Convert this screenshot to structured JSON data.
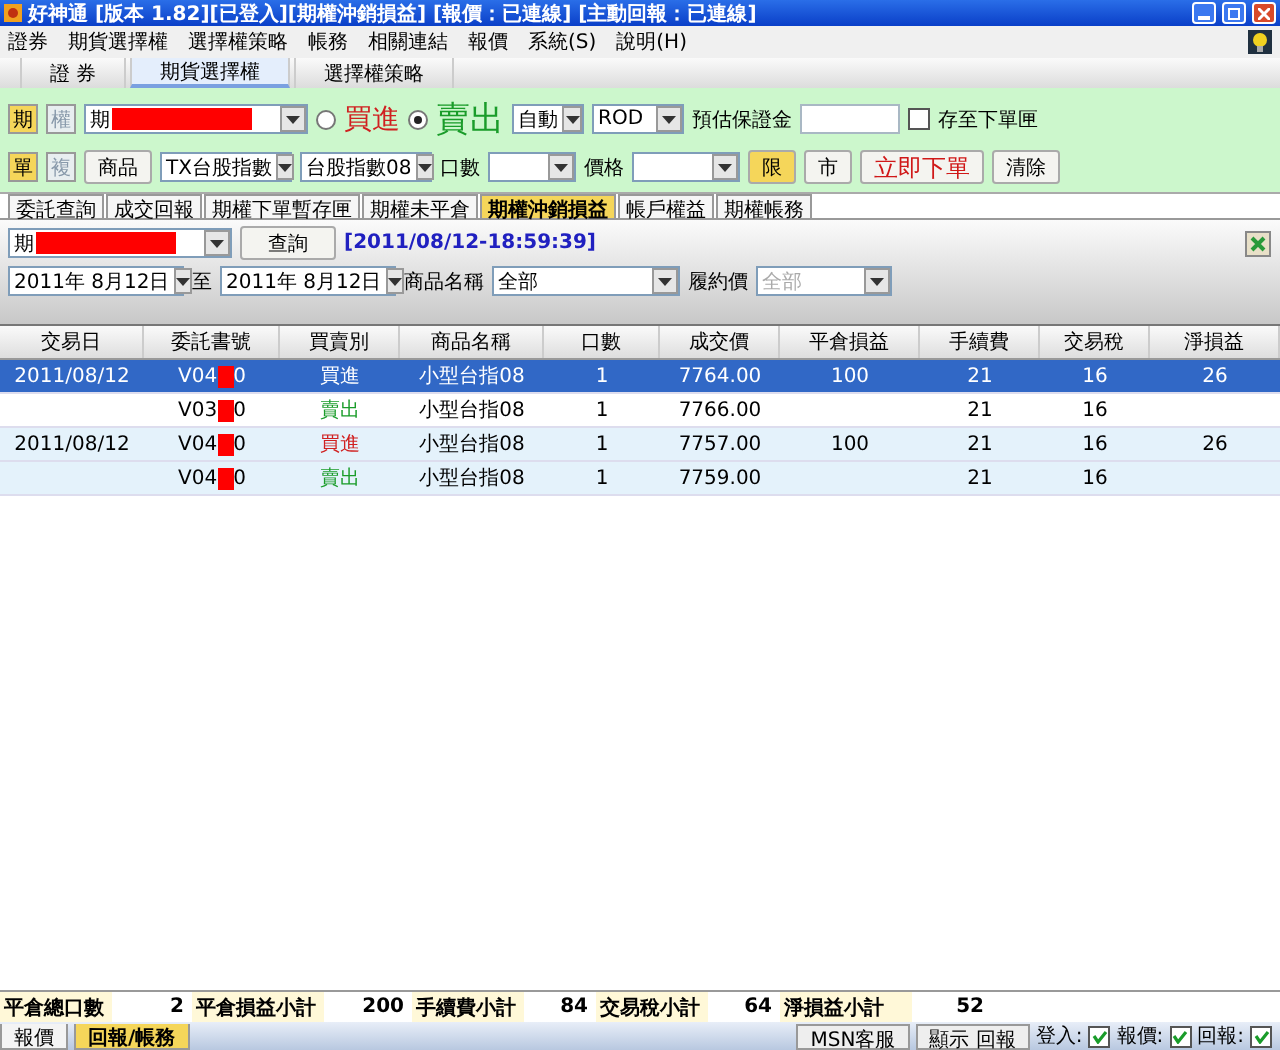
{
  "window": {
    "title": "好神通 [版本 1.82][已登入][期權沖銷損益] [報價：已連線] [主動回報：已連線]"
  },
  "menu": [
    "證券",
    "期貨選擇權",
    "選擇權策略",
    "帳務",
    "相關連結",
    "報價",
    "系統(S)",
    "說明(H)"
  ],
  "top_tabs": [
    {
      "label": "證 券",
      "selected": false
    },
    {
      "label": "期貨選擇權",
      "selected": true
    },
    {
      "label": "選擇權策略",
      "selected": false
    }
  ],
  "order": {
    "market_toggle": [
      {
        "label": "期",
        "selected": true
      },
      {
        "label": "權",
        "selected": false
      }
    ],
    "account": "期",
    "sides": [
      {
        "label": "買進",
        "selected": false
      },
      {
        "label": "賣出",
        "selected": true
      }
    ],
    "mode": "自動",
    "tif": "ROD",
    "margin_label": "預估保證金",
    "save_to_box": {
      "label": "存至下單匣",
      "checked": false
    },
    "order_type_toggle": [
      {
        "label": "單",
        "selected": true
      },
      {
        "label": "複",
        "selected": false
      }
    ],
    "product_button": "商品",
    "product": "TX台股指數",
    "contract": "台股指數08",
    "qty_label": "口數",
    "price_label": "價格",
    "price_type": [
      {
        "label": "限",
        "selected": true
      },
      {
        "label": "市",
        "selected": false
      }
    ],
    "submit": "立即下單",
    "clear": "清除"
  },
  "sub_tabs": [
    {
      "label": "委託查詢",
      "selected": false
    },
    {
      "label": "成交回報",
      "selected": false
    },
    {
      "label": "期權下單暫存匣",
      "selected": false
    },
    {
      "label": "期權未平倉",
      "selected": false
    },
    {
      "label": "期權沖銷損益",
      "selected": true
    },
    {
      "label": "帳戶權益",
      "selected": false
    },
    {
      "label": "期權帳務",
      "selected": false
    }
  ],
  "filter": {
    "account": "期",
    "query_button": "查詢",
    "timestamp": "[2011/08/12-18:59:39]",
    "date_from": "2011年  8月12日",
    "to_label": "至",
    "date_to": "2011年  8月12日",
    "product_label": "商品名稱",
    "product": "全部",
    "strike_label": "履約價",
    "strike": "全部",
    "strike_disabled": true
  },
  "table": {
    "columns": [
      "交易日",
      "委託書號",
      "買賣別",
      "商品名稱",
      "口數",
      "成交價",
      "平倉損益",
      "手續費",
      "交易稅",
      "淨損益"
    ],
    "rows": [
      {
        "selected": true,
        "shaded": false,
        "date": "2011/08/12",
        "order_head": "V04",
        "order_tail": "0",
        "side": "買進",
        "product": "小型台指08",
        "qty": "1",
        "price": "7764.00",
        "close_pl": "100",
        "fee": "21",
        "tax": "16",
        "net": "26"
      },
      {
        "selected": false,
        "shaded": false,
        "order_head": "V03",
        "order_tail": "0",
        "side": "賣出",
        "color": "#1a9c2a",
        "product": "小型台指08",
        "qty": "1",
        "price": "7766.00",
        "fee": "21",
        "tax": "16"
      },
      {
        "selected": false,
        "shaded": true,
        "date": "2011/08/12",
        "order_head": "V04",
        "order_tail": "0",
        "side": "買進",
        "color": "#d02020",
        "product": "小型台指08",
        "qty": "1",
        "price": "7757.00",
        "close_pl": "100",
        "fee": "21",
        "tax": "16",
        "net": "26"
      },
      {
        "selected": false,
        "shaded": true,
        "order_head": "V04",
        "order_tail": "0",
        "side": "賣出",
        "color": "#1a9c2a",
        "product": "小型台指08",
        "qty": "1",
        "price": "7759.00",
        "fee": "21",
        "tax": "16"
      }
    ]
  },
  "summary": [
    {
      "label": "平倉總口數",
      "value": "2"
    },
    {
      "label": "平倉損益小計",
      "value": "200"
    },
    {
      "label": "手續費小計",
      "value": "84"
    },
    {
      "label": "交易稅小計",
      "value": "64"
    },
    {
      "label": "淨損益小計",
      "value": "52"
    }
  ],
  "bottom_tabs": [
    {
      "label": "報價",
      "selected": false
    },
    {
      "label": "回報/帳務",
      "selected": true
    }
  ],
  "status": {
    "buttons": [
      "MSN客服",
      "顯示 回報"
    ],
    "indicators": [
      {
        "label": "登入:",
        "checked": true
      },
      {
        "label": "報價:",
        "checked": true
      },
      {
        "label": "回報:",
        "checked": true
      }
    ]
  }
}
